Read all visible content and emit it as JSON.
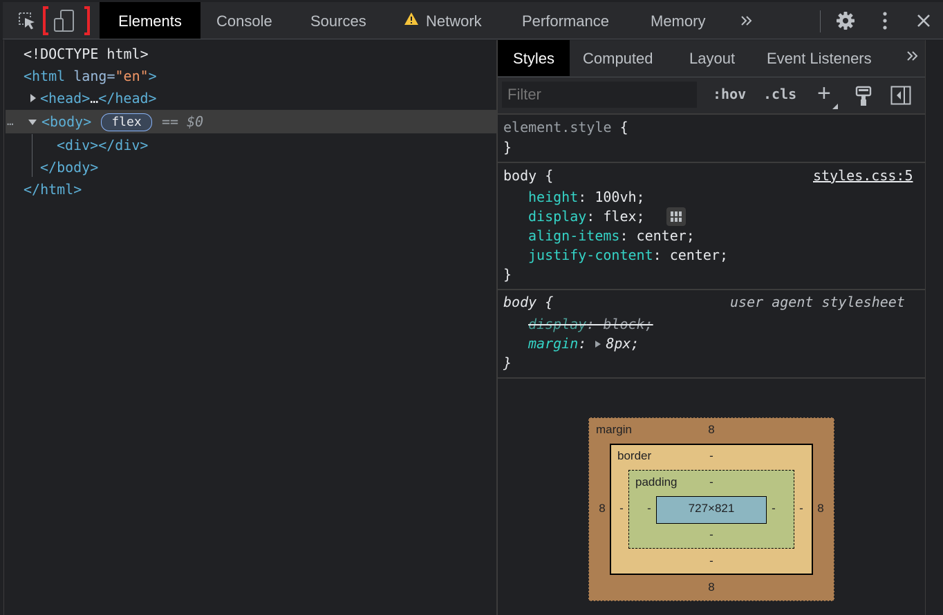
{
  "toolbar": {
    "tabs": [
      {
        "label": "Elements",
        "active": true
      },
      {
        "label": "Console"
      },
      {
        "label": "Sources"
      },
      {
        "label": "Network",
        "warning": true
      },
      {
        "label": "Performance"
      },
      {
        "label": "Memory"
      }
    ],
    "more_tabs_icon": "double-chevron-right-icon",
    "icons": [
      "inspect-element-icon",
      "device-toolbar-icon",
      "settings-gear-icon",
      "kebab-menu-icon",
      "close-icon"
    ],
    "highlight_color": "#e8242a"
  },
  "dom": {
    "doctype": "<!DOCTYPE html>",
    "html_open_tag": "<html",
    "html_attr_name": "lang",
    "html_attr_value": "\"en\"",
    "html_open_close": ">",
    "head_open": "<head>",
    "head_ellipsis": "…",
    "head_close": "</head>",
    "body_open": "<body>",
    "body_badge": "flex",
    "selected_marker": "== $0",
    "row_dots": "…",
    "div_line": "<div></div>",
    "body_close": "</body>",
    "html_close": "</html>"
  },
  "styles_pane": {
    "tabs": [
      {
        "label": "Styles",
        "active": true
      },
      {
        "label": "Computed"
      },
      {
        "label": "Layout"
      },
      {
        "label": "Event Listeners"
      }
    ],
    "filter_placeholder": "Filter",
    "hov_label": ":hov",
    "cls_label": ".cls",
    "plus_label": "+",
    "rules": {
      "element_style_selector": "element.style",
      "open_brace": "{",
      "close_brace": "}",
      "body_selector": "body",
      "body_source": "styles.css:5",
      "body_decls": [
        {
          "prop": "height",
          "value": "100vh;"
        },
        {
          "prop": "display",
          "value": "flex;"
        },
        {
          "prop": "align-items",
          "value": "center;"
        },
        {
          "prop": "justify-content",
          "value": "center;"
        }
      ],
      "ua_selector": "body",
      "ua_source": "user agent stylesheet",
      "ua_decl_1_prop": "display",
      "ua_decl_1_value": "block;",
      "ua_decl_2_prop": "margin",
      "ua_decl_2_value": "8px;"
    },
    "box_model": {
      "margin_label": "margin",
      "border_label": "border",
      "padding_label": "padding",
      "margin_top": "8",
      "margin_bottom": "8",
      "margin_left": "8",
      "margin_right": "8",
      "border_top": "-",
      "border_bottom": "-",
      "border_left": "-",
      "border_right": "-",
      "padding_top": "-",
      "padding_bottom": "-",
      "padding_left": "-",
      "padding_right": "-",
      "content_size": "727×821",
      "colors": {
        "margin": "#ad7f52",
        "border": "#e3c283",
        "padding": "#b8c484",
        "content": "#8cb6c1"
      }
    }
  }
}
